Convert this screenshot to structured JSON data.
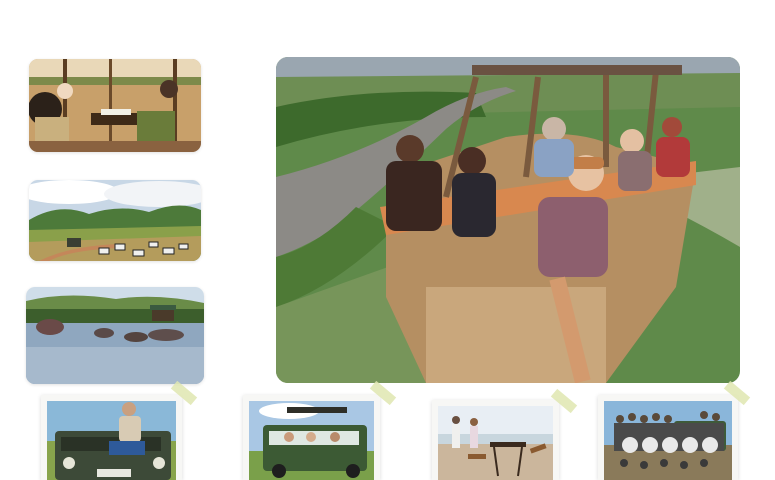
{
  "gallery": {
    "thumbnails": [
      {
        "id": "dining-tent"
      },
      {
        "id": "zebra-plains"
      },
      {
        "id": "hippo-river"
      }
    ],
    "hero": {
      "id": "balloon-selfie"
    },
    "polaroids": [
      {
        "id": "jeep-man"
      },
      {
        "id": "safari-jeep"
      },
      {
        "id": "beach-table"
      },
      {
        "id": "group-photo"
      }
    ]
  },
  "colors": {
    "tape": "#dfe6b0",
    "background": "#ffffff"
  }
}
